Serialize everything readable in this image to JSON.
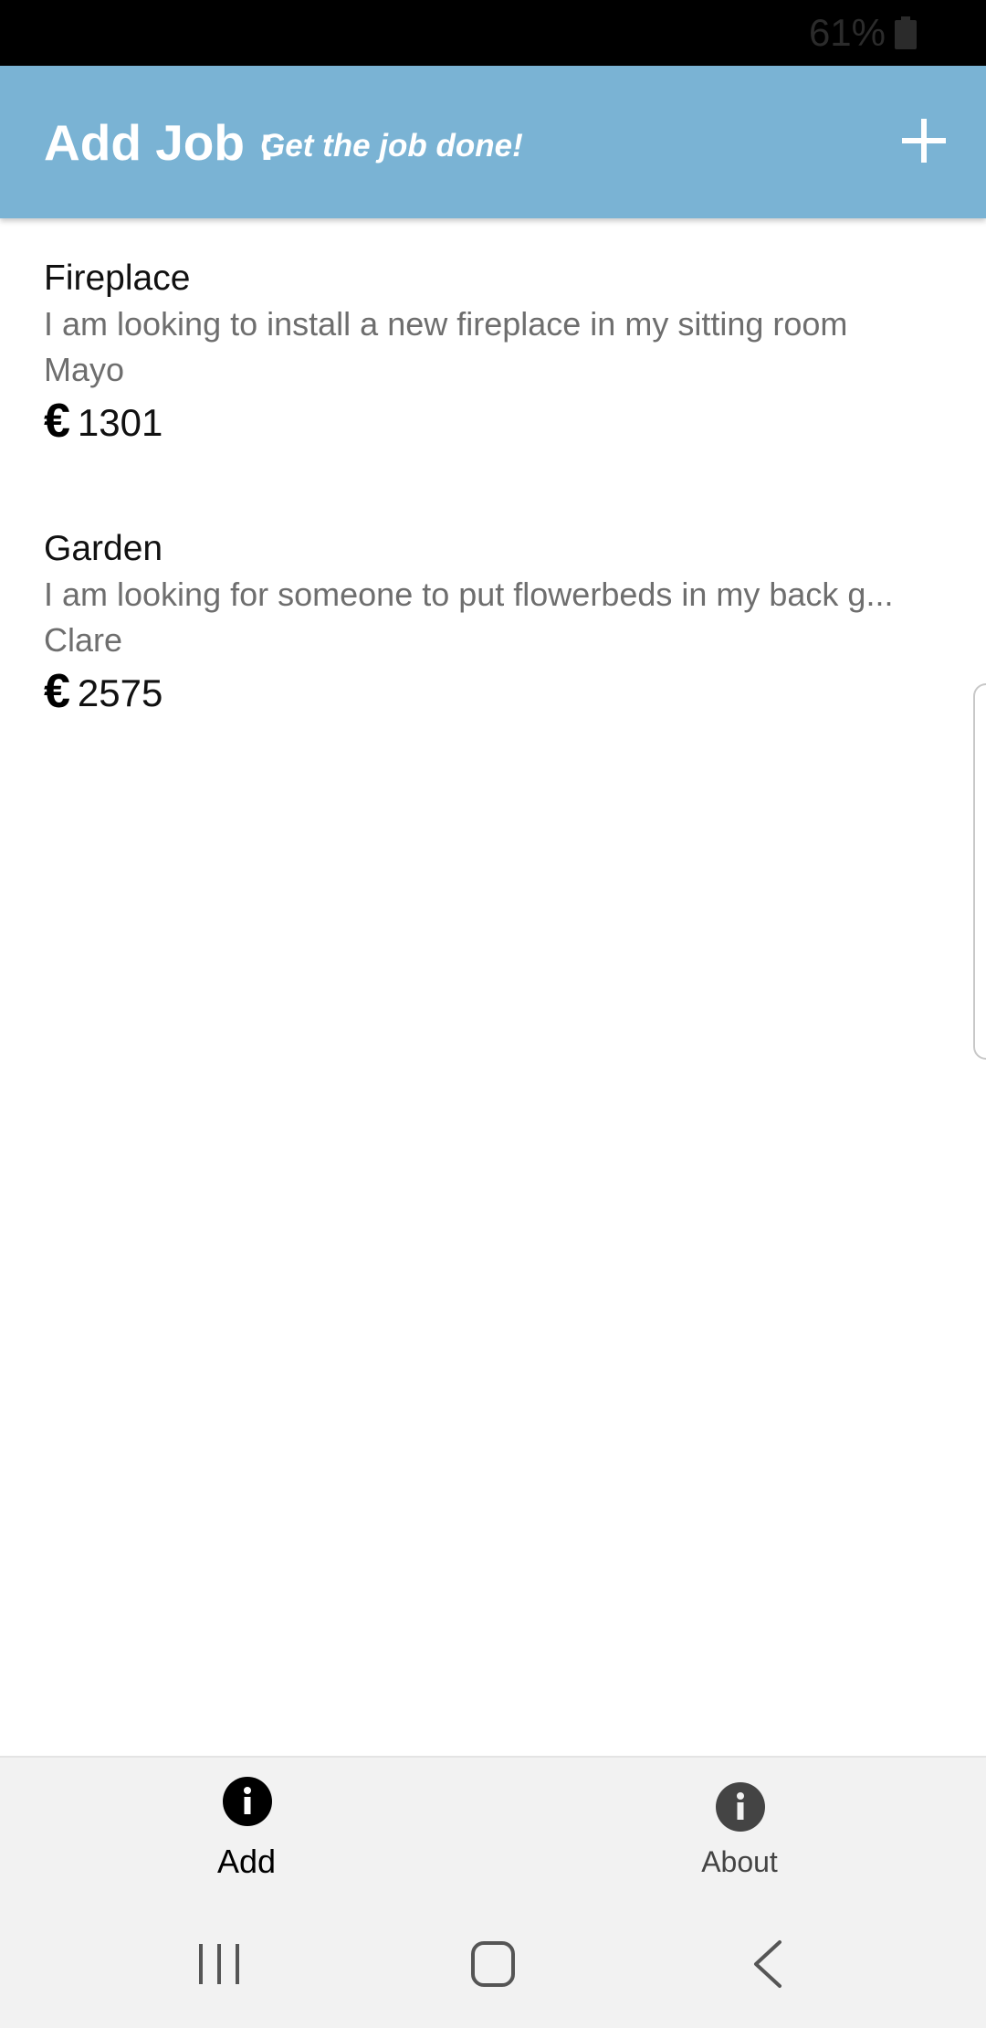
{
  "status_bar": {
    "battery_text": "61%"
  },
  "header": {
    "title": "Add Job :",
    "subtitle": "Get the job done!",
    "background_color": "#7ab3d4",
    "add_icon": "plus-icon"
  },
  "jobs": [
    {
      "title": "Fireplace",
      "description": "I am looking to install a new fireplace in my sitting room",
      "location": "Mayo",
      "currency_symbol": "€",
      "price": "1301"
    },
    {
      "title": "Garden",
      "description": "I am looking for someone to put flowerbeds in my back g...",
      "location": "Clare",
      "currency_symbol": "€",
      "price": "2575"
    }
  ],
  "tabs": [
    {
      "label": "Add",
      "icon": "info-icon",
      "active": true
    },
    {
      "label": "About",
      "icon": "info-icon",
      "active": false
    }
  ],
  "nav_bar": {
    "icons": [
      "recents-icon",
      "home-icon",
      "back-icon"
    ]
  }
}
